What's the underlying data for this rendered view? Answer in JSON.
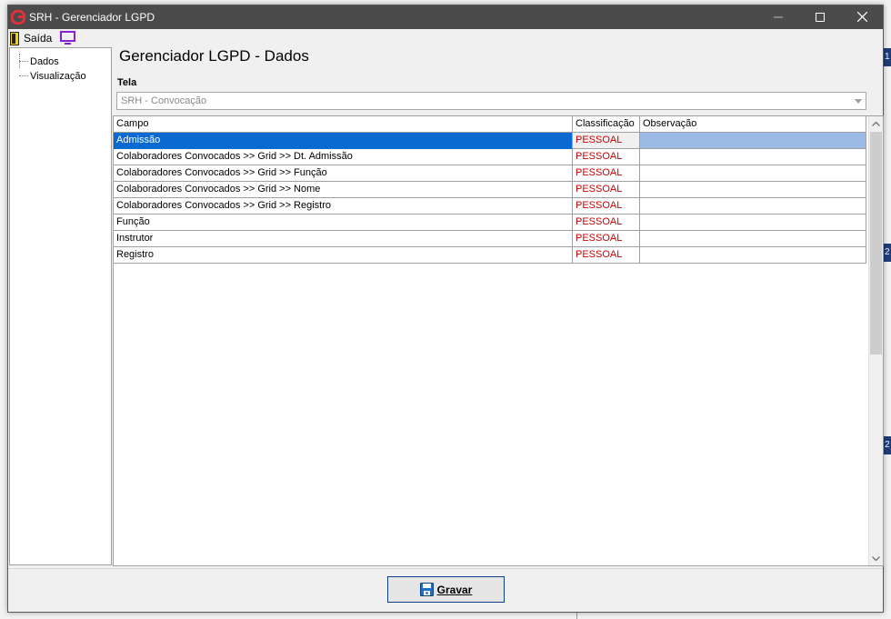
{
  "window": {
    "title": "SRH - Gerenciador LGPD"
  },
  "menu": {
    "exit_label": "Saída"
  },
  "tree": {
    "items": [
      {
        "label": "Dados"
      },
      {
        "label": "Visualização"
      }
    ]
  },
  "page": {
    "title": "Gerenciador LGPD - Dados",
    "screen_label": "Tela",
    "screen_value": "SRH - Convocação"
  },
  "grid": {
    "columns": [
      "Campo",
      "Classificação",
      "Observação"
    ],
    "rows": [
      {
        "campo": "Admissão",
        "classificacao": "PESSOAL",
        "observacao": ""
      },
      {
        "campo": "Colaboradores Convocados >> Grid >> Dt. Admissão",
        "classificacao": "PESSOAL",
        "observacao": ""
      },
      {
        "campo": "Colaboradores Convocados >> Grid >> Função",
        "classificacao": "PESSOAL",
        "observacao": ""
      },
      {
        "campo": "Colaboradores Convocados >> Grid >> Nome",
        "classificacao": "PESSOAL",
        "observacao": ""
      },
      {
        "campo": "Colaboradores Convocados >> Grid >> Registro",
        "classificacao": "PESSOAL",
        "observacao": ""
      },
      {
        "campo": "Função",
        "classificacao": "PESSOAL",
        "observacao": ""
      },
      {
        "campo": "Instrutor",
        "classificacao": "PESSOAL",
        "observacao": ""
      },
      {
        "campo": "Registro",
        "classificacao": "PESSOAL",
        "observacao": ""
      }
    ]
  },
  "footer": {
    "save_label": "Gravar"
  },
  "background": {
    "strip_labels": [
      "1",
      "2",
      "2"
    ]
  },
  "colors": {
    "titlebar": "#4b4b4b",
    "selection": "#0a6ad1",
    "classification_text": "#cc0000",
    "accent_purple": "#8b1fd6"
  },
  "icons": [
    "app-logo-icon",
    "exit-door-icon",
    "monitor-icon",
    "dropdown-arrow-icon",
    "scroll-up-icon",
    "scroll-down-icon",
    "floppy-disk-icon"
  ]
}
